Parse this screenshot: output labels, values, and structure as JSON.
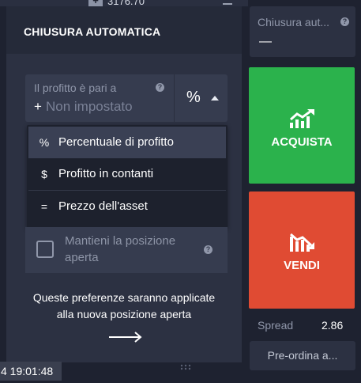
{
  "background": {
    "top_price": "3176.70",
    "top_plus": "+"
  },
  "panel": {
    "title": "CHIUSURA AUTOMATICA",
    "profit": {
      "label": "Il profitto è pari a",
      "help": "?",
      "prefix": "+",
      "placeholder": "Non impostato",
      "unit": "%"
    },
    "dropdown": [
      {
        "symbol": "%",
        "label": "Percentuale di profitto",
        "selected": true
      },
      {
        "symbol": "$",
        "label": "Profitto in contanti",
        "selected": false
      },
      {
        "symbol": "=",
        "label": "Prezzo dell'asset",
        "selected": false
      }
    ],
    "hold_position": {
      "label": "Mantieni la posizione aperta",
      "help": "?",
      "checked": false
    },
    "note_line1": "Queste preferenze saranno applicate",
    "note_line2": "alla nuova posizione aperta"
  },
  "sidebar": {
    "auto_close": {
      "label": "Chiusura aut...",
      "help": "?",
      "value": "—"
    },
    "buy_label": "ACQUISTA",
    "sell_label": "VENDI",
    "spread_label": "Spread",
    "spread_value": "2.86",
    "preorder_label": "Pre-ordina a..."
  },
  "footer": {
    "time": "4 19:01:48"
  },
  "colors": {
    "buy": "#2bb24c",
    "sell": "#e04b33",
    "panel": "#2c3142",
    "background": "#1e2230"
  },
  "icons": [
    "chart-up-icon",
    "chart-down-icon",
    "help-icon",
    "arrow-right-icon",
    "caret-up-icon",
    "grip-icon"
  ]
}
